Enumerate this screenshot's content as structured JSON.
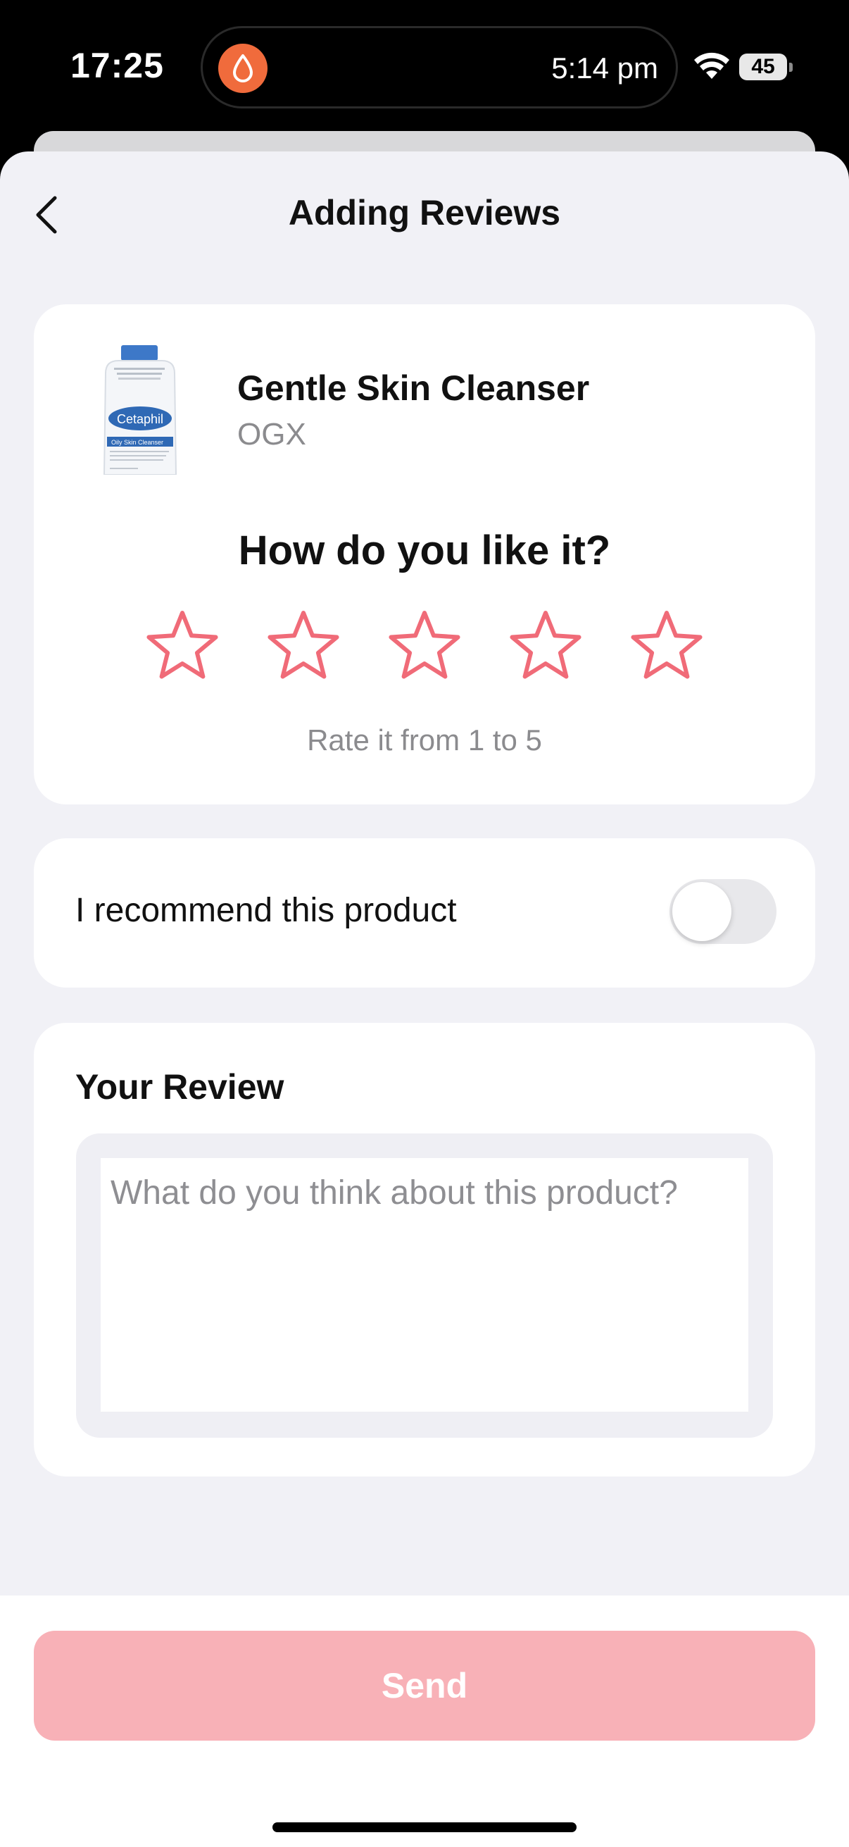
{
  "status_bar": {
    "time": "17:25",
    "island_time": "5:14 pm",
    "battery": "45",
    "island_icon": "water-drop-icon"
  },
  "header": {
    "title": "Adding Reviews",
    "back_icon": "chevron-left-icon"
  },
  "product": {
    "name": "Gentle Skin Cleanser",
    "brand": "OGX",
    "image_brand_text": "Cetaphil",
    "image_line": "Oily Skin Cleanser"
  },
  "rating": {
    "question": "How do you like it?",
    "hint": "Rate it from 1 to 5",
    "max_stars": 5,
    "selected": 0,
    "star_color": "#f06b78"
  },
  "recommend": {
    "label": "I recommend this product",
    "enabled": false
  },
  "review": {
    "heading": "Your Review",
    "placeholder": "What do you think about this product?",
    "value": ""
  },
  "footer": {
    "send_label": "Send",
    "send_color": "#f8b1b7"
  }
}
